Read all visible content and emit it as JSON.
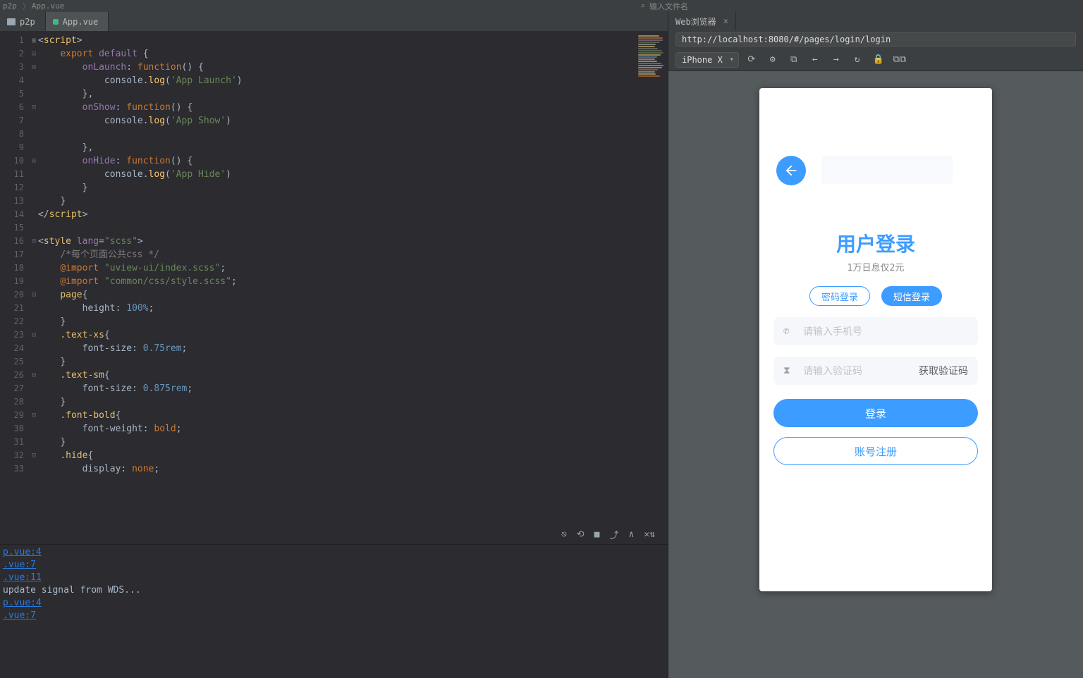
{
  "breadcrumb": {
    "root": "p2p",
    "file": "App.vue"
  },
  "topbar_mid_placeholder": "输入文件名",
  "tabs": {
    "folder": "p2p",
    "active": "App.vue"
  },
  "editor": {
    "lines": [
      {
        "n": 1,
        "f": "▣",
        "seg": [
          [
            "t-br",
            "<"
          ],
          [
            "t-tag",
            "script"
          ],
          [
            "t-br",
            ">"
          ]
        ]
      },
      {
        "n": 2,
        "f": "⊟",
        "seg": [
          [
            "",
            "    "
          ],
          [
            "t-kw",
            "export "
          ],
          [
            "t-def",
            "default"
          ],
          [
            "t-br",
            " {"
          ]
        ]
      },
      {
        "n": 3,
        "f": "⊟",
        "seg": [
          [
            "",
            "        "
          ],
          [
            "t-def",
            "onLaunch"
          ],
          [
            "t-br",
            ": "
          ],
          [
            "t-kw",
            "function"
          ],
          [
            "t-br",
            "() {"
          ]
        ]
      },
      {
        "n": 4,
        "f": "",
        "seg": [
          [
            "",
            "            console."
          ],
          [
            "t-fn",
            "log"
          ],
          [
            "t-br",
            "("
          ],
          [
            "t-str",
            "'App Launch'"
          ],
          [
            "t-br",
            ")"
          ]
        ]
      },
      {
        "n": 5,
        "f": "",
        "seg": [
          [
            "",
            "        "
          ],
          [
            "t-br",
            "},"
          ]
        ]
      },
      {
        "n": 6,
        "f": "⊟",
        "seg": [
          [
            "",
            "        "
          ],
          [
            "t-def",
            "onShow"
          ],
          [
            "t-br",
            ": "
          ],
          [
            "t-kw",
            "function"
          ],
          [
            "t-br",
            "() {"
          ]
        ]
      },
      {
        "n": 7,
        "f": "",
        "seg": [
          [
            "",
            "            console."
          ],
          [
            "t-fn",
            "log"
          ],
          [
            "t-br",
            "("
          ],
          [
            "t-str",
            "'App Show'"
          ],
          [
            "t-br",
            ")"
          ]
        ]
      },
      {
        "n": 8,
        "f": "",
        "seg": [
          [
            "",
            " "
          ]
        ]
      },
      {
        "n": 9,
        "f": "",
        "seg": [
          [
            "",
            "        "
          ],
          [
            "t-br",
            "},"
          ]
        ]
      },
      {
        "n": 10,
        "f": "⊟",
        "seg": [
          [
            "",
            "        "
          ],
          [
            "t-def",
            "onHide"
          ],
          [
            "t-br",
            ": "
          ],
          [
            "t-kw",
            "function"
          ],
          [
            "t-br",
            "() {"
          ]
        ]
      },
      {
        "n": 11,
        "f": "",
        "seg": [
          [
            "",
            "            console."
          ],
          [
            "t-fn",
            "log"
          ],
          [
            "t-br",
            "("
          ],
          [
            "t-str",
            "'App Hide'"
          ],
          [
            "t-br",
            ")"
          ]
        ]
      },
      {
        "n": 12,
        "f": "",
        "seg": [
          [
            "",
            "        "
          ],
          [
            "t-br",
            "}"
          ]
        ]
      },
      {
        "n": 13,
        "f": "",
        "seg": [
          [
            "",
            "    "
          ],
          [
            "t-br",
            "}"
          ]
        ]
      },
      {
        "n": 14,
        "f": "",
        "seg": [
          [
            "t-br",
            "</"
          ],
          [
            "t-tag",
            "script"
          ],
          [
            "t-br",
            ">"
          ]
        ]
      },
      {
        "n": 15,
        "f": "",
        "seg": [
          [
            "",
            " "
          ]
        ]
      },
      {
        "n": 16,
        "f": "⊟",
        "seg": [
          [
            "t-br",
            "<"
          ],
          [
            "t-tag",
            "style "
          ],
          [
            "t-def",
            "lang"
          ],
          [
            "t-br",
            "="
          ],
          [
            "t-str",
            "\"scss\""
          ],
          [
            "t-br",
            ">"
          ]
        ]
      },
      {
        "n": 17,
        "f": "",
        "seg": [
          [
            "",
            "    "
          ],
          [
            "t-cmt",
            "/*每个页面公共css */"
          ]
        ]
      },
      {
        "n": 18,
        "f": "",
        "seg": [
          [
            "",
            "    "
          ],
          [
            "t-kw",
            "@import "
          ],
          [
            "t-str",
            "\"uview-ui/index.scss\""
          ],
          [
            "t-br",
            ";"
          ]
        ]
      },
      {
        "n": 19,
        "f": "",
        "seg": [
          [
            "",
            "    "
          ],
          [
            "t-kw",
            "@import "
          ],
          [
            "t-str",
            "\"common/css/style.scss\""
          ],
          [
            "t-br",
            ";"
          ]
        ]
      },
      {
        "n": 20,
        "f": "⊟",
        "seg": [
          [
            "",
            "    "
          ],
          [
            "t-sel",
            "page"
          ],
          [
            "t-br",
            "{"
          ]
        ]
      },
      {
        "n": 21,
        "f": "",
        "seg": [
          [
            "",
            "        "
          ],
          [
            "t-prop",
            "height"
          ],
          [
            "t-br",
            ": "
          ],
          [
            "t-num",
            "100%"
          ],
          [
            "t-br",
            ";"
          ]
        ]
      },
      {
        "n": 22,
        "f": "",
        "seg": [
          [
            "",
            "    "
          ],
          [
            "t-br",
            "}"
          ]
        ]
      },
      {
        "n": 23,
        "f": "⊟",
        "seg": [
          [
            "",
            "    "
          ],
          [
            "t-sel",
            ".text-xs"
          ],
          [
            "t-br",
            "{"
          ]
        ]
      },
      {
        "n": 24,
        "f": "",
        "seg": [
          [
            "",
            "        "
          ],
          [
            "t-prop",
            "font-size"
          ],
          [
            "t-br",
            ": "
          ],
          [
            "t-num",
            "0.75rem"
          ],
          [
            "t-br",
            ";"
          ]
        ]
      },
      {
        "n": 25,
        "f": "",
        "seg": [
          [
            "",
            "    "
          ],
          [
            "t-br",
            "}"
          ]
        ]
      },
      {
        "n": 26,
        "f": "⊟",
        "seg": [
          [
            "",
            "    "
          ],
          [
            "t-sel",
            ".text-sm"
          ],
          [
            "t-br",
            "{"
          ]
        ]
      },
      {
        "n": 27,
        "f": "",
        "seg": [
          [
            "",
            "        "
          ],
          [
            "t-prop",
            "font-size"
          ],
          [
            "t-br",
            ": "
          ],
          [
            "t-num",
            "0.875rem"
          ],
          [
            "t-br",
            ";"
          ]
        ]
      },
      {
        "n": 28,
        "f": "",
        "seg": [
          [
            "",
            "    "
          ],
          [
            "t-br",
            "}"
          ]
        ]
      },
      {
        "n": 29,
        "f": "⊟",
        "seg": [
          [
            "",
            "    "
          ],
          [
            "t-sel",
            ".font-bold"
          ],
          [
            "t-br",
            "{"
          ]
        ]
      },
      {
        "n": 30,
        "f": "",
        "seg": [
          [
            "",
            "        "
          ],
          [
            "t-prop",
            "font-weight"
          ],
          [
            "t-br",
            ": "
          ],
          [
            "t-kw",
            "bold"
          ],
          [
            "t-br",
            ";"
          ]
        ]
      },
      {
        "n": 31,
        "f": "",
        "seg": [
          [
            "",
            "    "
          ],
          [
            "t-br",
            "}"
          ]
        ]
      },
      {
        "n": 32,
        "f": "⊟",
        "seg": [
          [
            "",
            "    "
          ],
          [
            "t-sel",
            ".hide"
          ],
          [
            "t-br",
            "{"
          ]
        ]
      },
      {
        "n": 33,
        "f": "",
        "seg": [
          [
            "",
            "        "
          ],
          [
            "t-prop",
            "display"
          ],
          [
            "t-br",
            ": "
          ],
          [
            "t-kw",
            "none"
          ],
          [
            "t-br",
            ";"
          ]
        ]
      }
    ]
  },
  "console": {
    "tools": [
      "⎋",
      "⟲",
      "■",
      "⤴",
      "∧",
      "✕⇅"
    ],
    "lines": [
      {
        "cls": "link",
        "t": "p.vue:4"
      },
      {
        "cls": "link",
        "t": ".vue:7"
      },
      {
        "cls": "link",
        "t": ".vue:11"
      },
      {
        "cls": "plain",
        "t": "  update signal from WDS..."
      },
      {
        "cls": "link",
        "t": "p.vue:4"
      },
      {
        "cls": "link",
        "t": ".vue:7"
      }
    ]
  },
  "browser": {
    "tab": "Web浏览器",
    "address": "http://localhost:8080/#/pages/login/login",
    "device": "iPhone X",
    "toolbar_icons": [
      "⟳",
      "⚙",
      "⧉",
      "←",
      "→",
      "↻",
      "🔒",
      "⧉⧉"
    ],
    "page": {
      "title": "用户登录",
      "subtitle": "1万日息仅2元",
      "seg_outline": "密码登录",
      "seg_solid": "短信登录",
      "field_phone_ph": "请输入手机号",
      "field_code_ph": "请输入验证码",
      "get_code": "获取验证码",
      "login_btn": "登录",
      "register_btn": "账号注册"
    }
  },
  "minimap_colors": [
    "#e8bf6a",
    "#cc7832",
    "#9876aa",
    "#6a8759",
    "#a9b7c6",
    "#e8bf6a",
    "#808080",
    "#6a8759",
    "#6a8759",
    "#e8bf6a",
    "#6897bb",
    "#a9b7c6",
    "#e8bf6a",
    "#6897bb",
    "#a9b7c6",
    "#e8bf6a",
    "#cc7832",
    "#a9b7c6",
    "#e8bf6a",
    "#cc7832"
  ]
}
